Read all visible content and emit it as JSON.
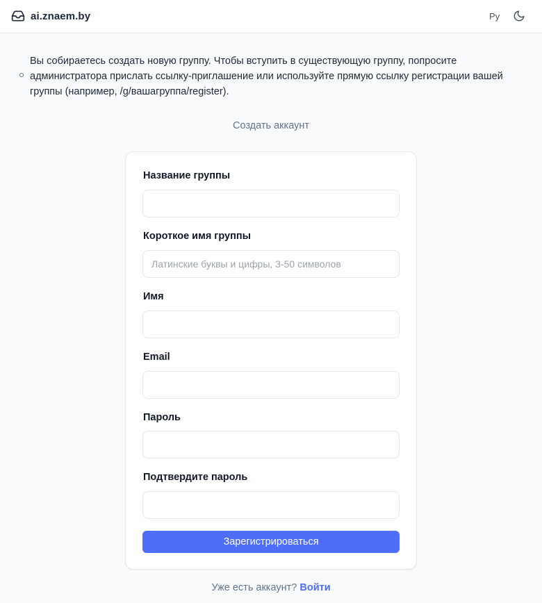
{
  "header": {
    "brand": "ai.znaem.by",
    "brand_icon": "inbox-icon",
    "language": "Ру",
    "theme_icon": "moon-icon"
  },
  "notice": {
    "text": "Вы собираетесь создать новую группу. Чтобы вступить в существующую группу, попросите администратора прислать ссылку-приглашение или используйте прямую ссылку регистрации вашей группы (например, /g/вашагруппа/register)."
  },
  "page": {
    "title": "Создать аккаунт"
  },
  "form": {
    "fields": [
      {
        "label": "Название группы",
        "value": "",
        "placeholder": ""
      },
      {
        "label": "Короткое имя группы",
        "value": "",
        "placeholder": "Латинские буквы и цифры, 3-50 символов"
      },
      {
        "label": "Имя",
        "value": "",
        "placeholder": ""
      },
      {
        "label": "Email",
        "value": "",
        "placeholder": ""
      },
      {
        "label": "Пароль",
        "value": "",
        "placeholder": ""
      },
      {
        "label": "Подтвердите пароль",
        "value": "",
        "placeholder": ""
      }
    ],
    "submit_label": "Зарегистрироваться"
  },
  "footer": {
    "prompt": "Уже есть аккаунт?",
    "login_link": "Войти"
  },
  "colors": {
    "accent": "#4f6ef7",
    "background": "#f8fafc",
    "muted_text": "#64748b"
  }
}
